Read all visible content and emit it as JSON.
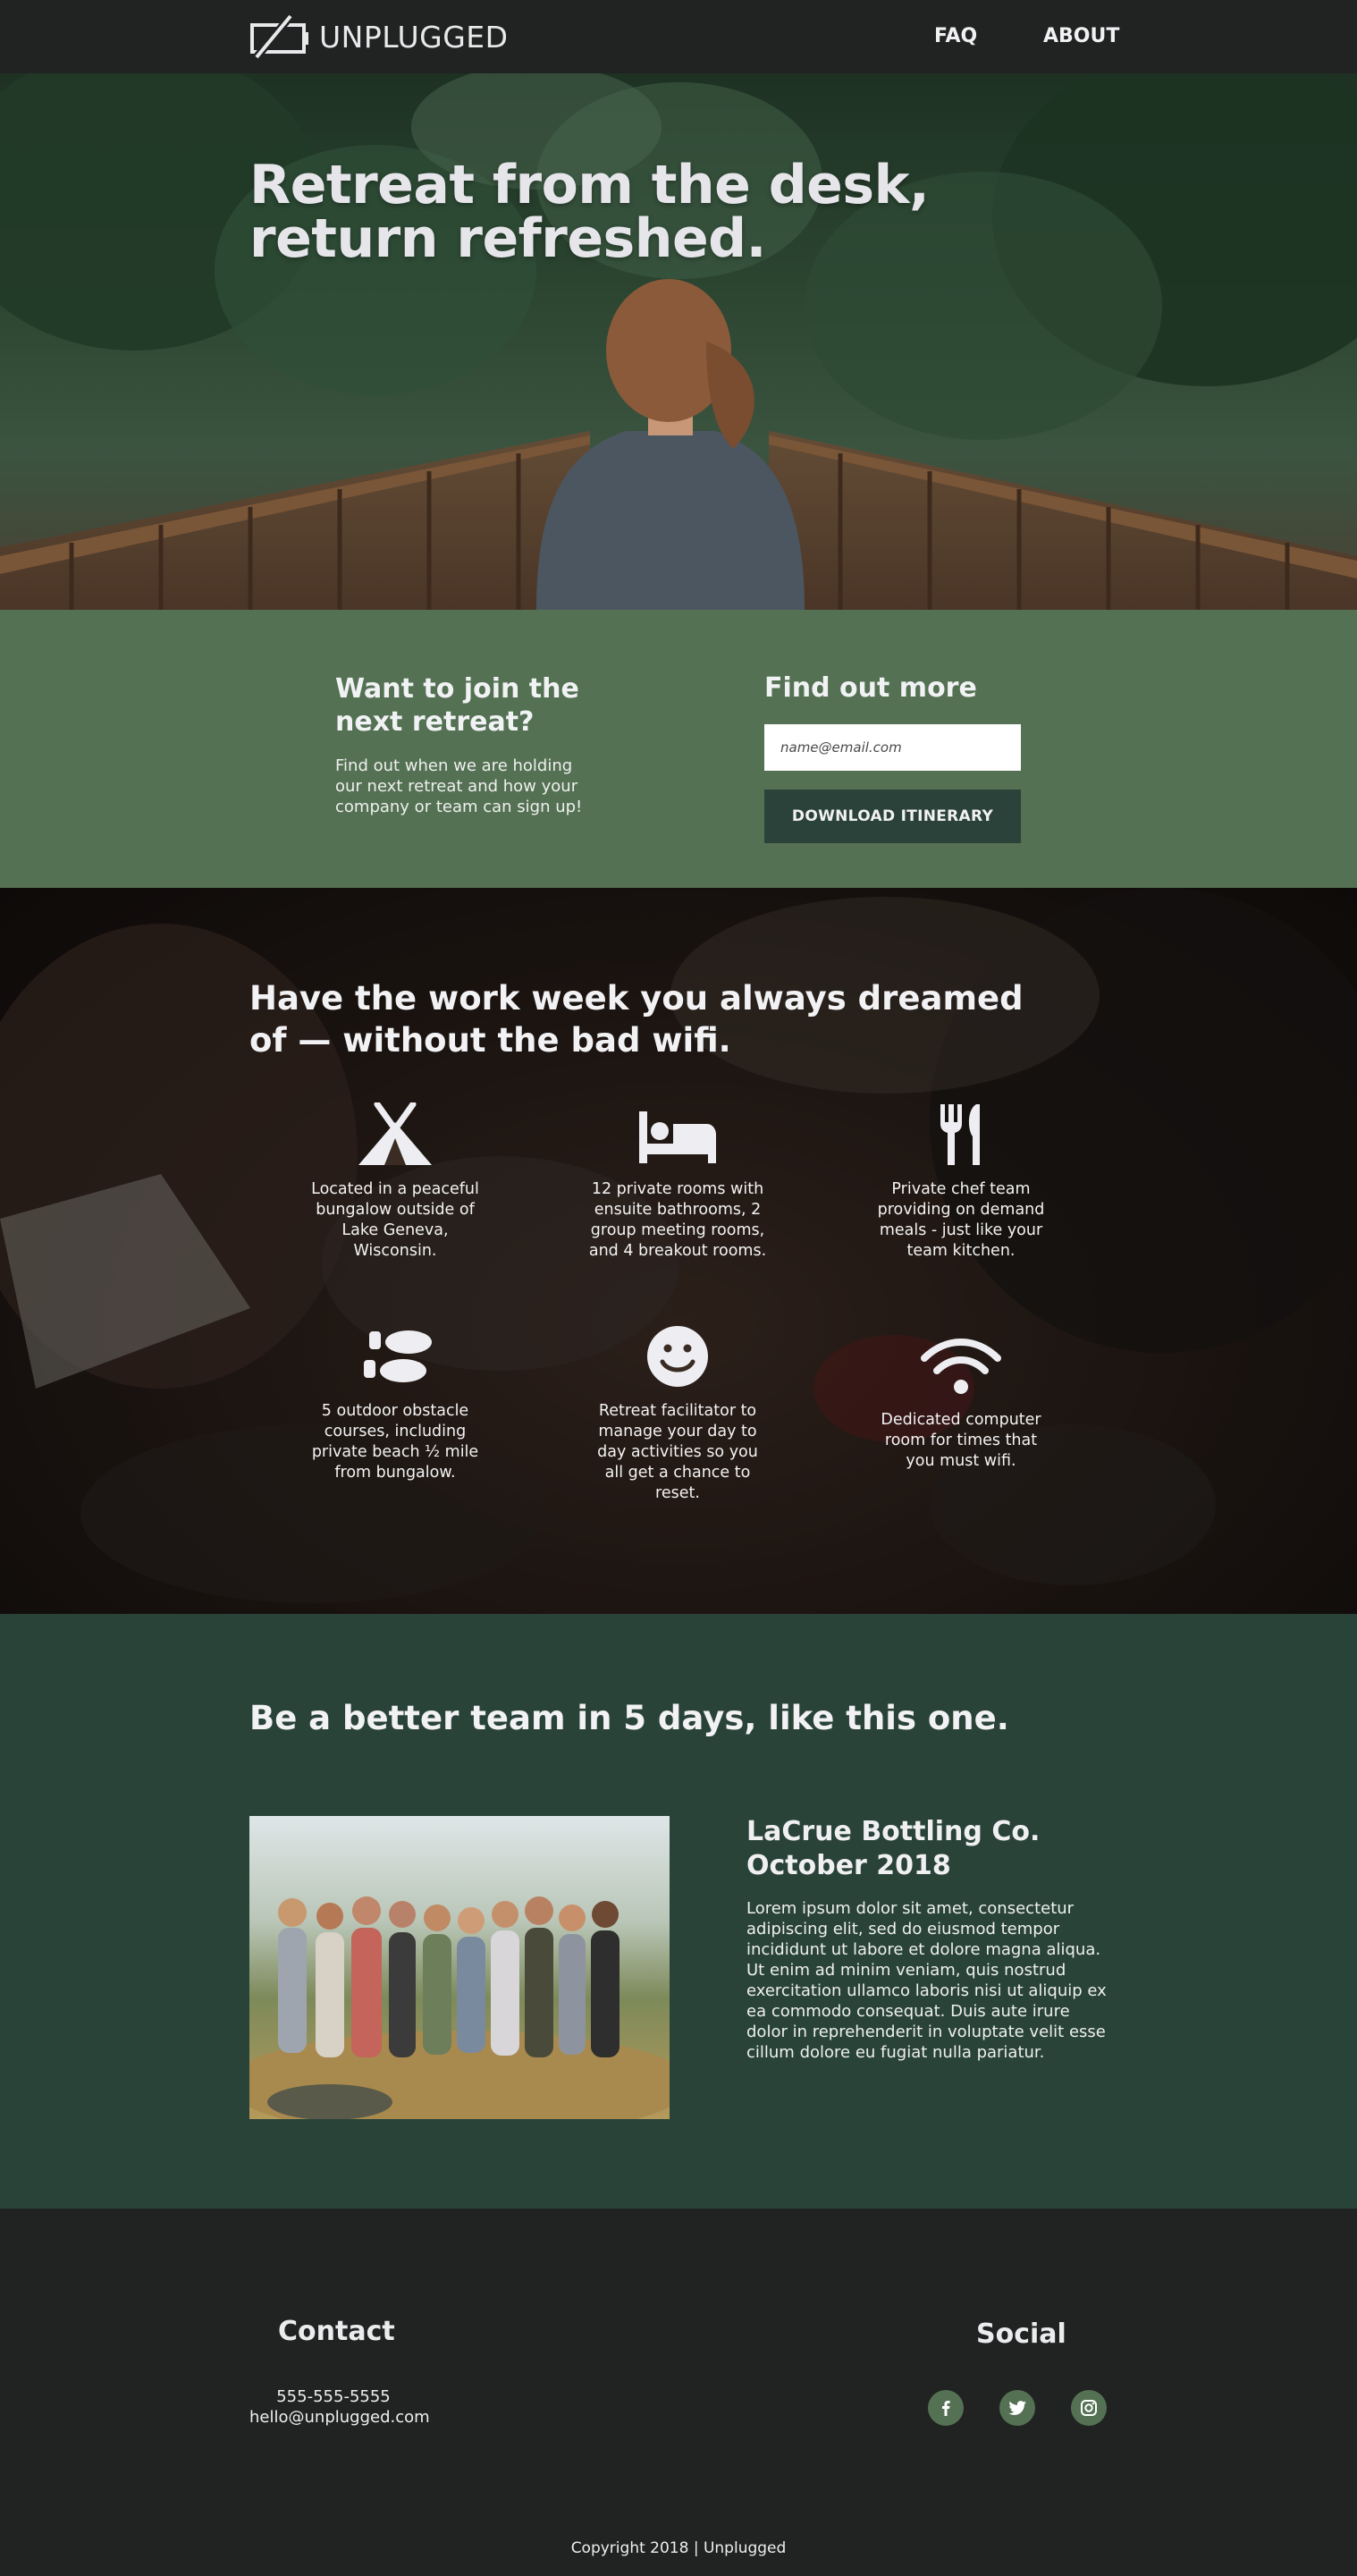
{
  "nav": {
    "logo_text": "UNPLUGGED",
    "links": [
      {
        "label": "FAQ"
      },
      {
        "label": "ABOUT"
      }
    ]
  },
  "hero": {
    "title": "Retreat from the desk, return refreshed."
  },
  "signup": {
    "join_title": "Want to join the next retreat?",
    "join_text": "Find out when we are holding our next retreat and how your company or team can sign up!",
    "find_title": "Find out more",
    "email_placeholder": "name@email.com",
    "email_value": "",
    "button_label": "DOWNLOAD ITINERARY"
  },
  "features": {
    "title": "Have the work week you always dreamed of — without the bad wifi.",
    "items": [
      {
        "icon": "tent-icon",
        "text": "Located in a peaceful bungalow outside of Lake Geneva, Wisconsin."
      },
      {
        "icon": "bed-icon",
        "text": "12 private rooms with ensuite bathrooms, 2 group meeting rooms, and 4 breakout rooms."
      },
      {
        "icon": "utensils-icon",
        "text": "Private chef team providing on demand meals - just like your team kitchen."
      },
      {
        "icon": "footprints-icon",
        "text": "5 outdoor obstacle courses, including private beach ½ mile from bungalow."
      },
      {
        "icon": "smile-icon",
        "text": "Retreat facilitator to manage your day to day activities so you all get a chance to reset."
      },
      {
        "icon": "wifi-icon",
        "text": "Dedicated computer room for times that you must wifi."
      }
    ]
  },
  "team": {
    "title": "Be a better team in 5 days, like this one.",
    "case_title": "LaCrue Bottling Co. October 2018",
    "case_text": "Lorem ipsum dolor sit amet, consectetur adipiscing elit, sed do eiusmod tempor incididunt ut labore et dolore magna aliqua. Ut enim ad minim veniam, quis nostrud exercitation ullamco laboris nisi ut aliquip ex ea commodo consequat. Duis aute irure dolor in reprehenderit in voluptate velit esse cillum dolore eu fugiat nulla pariatur."
  },
  "footer": {
    "contact_title": "Contact",
    "phone": "555-555-5555",
    "email": "hello@unplugged.com",
    "social_title": "Social",
    "social_icons": [
      "facebook-icon",
      "twitter-icon",
      "instagram-icon"
    ],
    "copyright": "Copyright 2018 | Unplugged"
  },
  "colors": {
    "nav_bg": "#212322",
    "signup_bg": "#557154",
    "button_bg": "#2a4239",
    "team_bg": "#2a4339",
    "footer_bg": "#212322",
    "social_bg": "#557154"
  }
}
